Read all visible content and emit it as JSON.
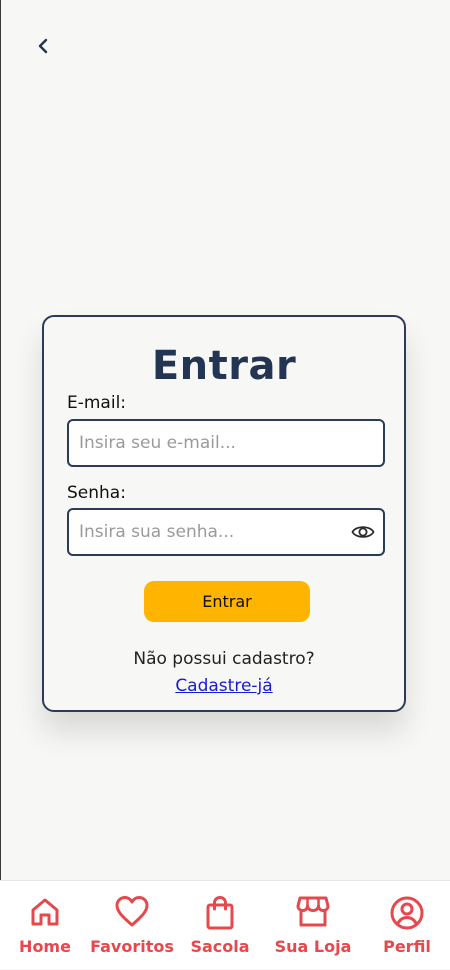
{
  "header": {
    "back_icon": "chevron-left-icon"
  },
  "login": {
    "title": "Entrar",
    "email_label": "E-mail:",
    "email_placeholder": "Insira seu e-mail...",
    "email_value": "",
    "password_label": "Senha:",
    "password_placeholder": "Insira sua senha...",
    "password_value": "",
    "password_toggle_icon": "eye-icon",
    "submit_label": "Entrar",
    "signup_question": "Não possui cadastro?",
    "signup_link": "Cadastre-já"
  },
  "colors": {
    "background": "#f7f7f5",
    "card_border": "#2b3b58",
    "title": "#233552",
    "button": "#ffb400",
    "link": "#1a1ad6",
    "nav_accent": "#e5484d"
  },
  "bottom_nav": {
    "items": [
      {
        "label": "Home",
        "icon": "home-icon"
      },
      {
        "label": "Favoritos",
        "icon": "heart-icon"
      },
      {
        "label": "Sacola",
        "icon": "shopping-bag-icon"
      },
      {
        "label": "Sua Loja",
        "icon": "store-icon"
      },
      {
        "label": "Perfil",
        "icon": "user-circle-icon"
      }
    ]
  }
}
